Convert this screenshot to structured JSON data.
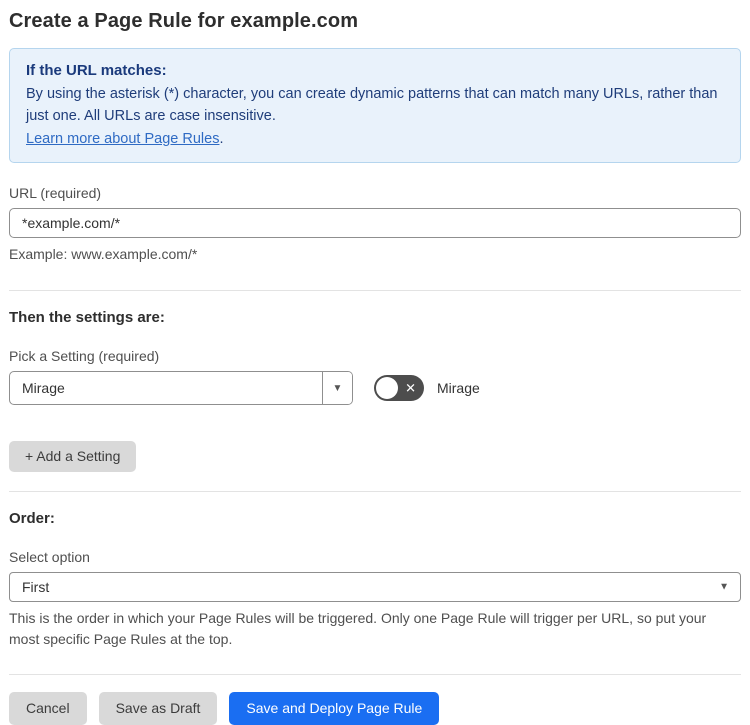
{
  "page": {
    "title": "Create a Page Rule for example.com"
  },
  "info_box": {
    "heading": "If the URL matches:",
    "body": "By using the asterisk (*) character, you can create dynamic patterns that can match many URLs, rather than just one. All URLs are case insensitive.",
    "link_label": "Learn more about Page Rules",
    "link_suffix": "."
  },
  "url_field": {
    "label": "URL (required)",
    "value": "*example.com/*",
    "helper": "Example: www.example.com/*"
  },
  "settings_section": {
    "heading": "Then the settings are:",
    "picker_label": "Pick a Setting (required)",
    "picker_value": "Mirage",
    "toggle_label": "Mirage",
    "toggle_state": "off",
    "add_button_label": "+ Add a Setting"
  },
  "order_section": {
    "heading": "Order:",
    "select_label": "Select option",
    "select_value": "First",
    "helper": "This is the order in which your Page Rules will be triggered. Only one Page Rule will trigger per URL, so put your most specific Page Rules at the top."
  },
  "footer": {
    "cancel_label": "Cancel",
    "save_draft_label": "Save as Draft",
    "save_deploy_label": "Save and Deploy Page Rule"
  },
  "icons": {
    "dropdown_arrow": "▼",
    "toggle_x": "✕"
  },
  "colors": {
    "accent_blue": "#1a6ef2",
    "info_bg": "#e9f2fb",
    "info_border": "#b5d5ee",
    "info_text": "#1f3d7a",
    "link_blue": "#2f6bc4",
    "toggle_off_bg": "#4d4d4d",
    "gray_button_bg": "#d9d9d9"
  }
}
